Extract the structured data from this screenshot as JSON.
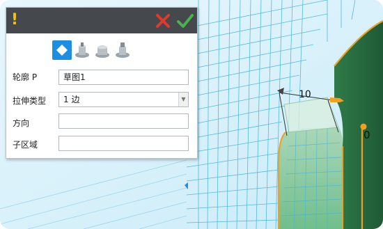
{
  "dialog": {
    "warn_glyph": "!",
    "cancel_icon": "close-x-icon",
    "ok_icon": "check-icon",
    "tools": [
      {
        "icon": "profile-diamond-icon",
        "active": true
      },
      {
        "icon": "extrude-solid-icon",
        "active": false
      },
      {
        "icon": "extrude-shell-icon",
        "active": false
      },
      {
        "icon": "extrude-cut-icon",
        "active": false
      }
    ],
    "fields": {
      "profile": {
        "label": "轮廓 P",
        "value": "草图1"
      },
      "extrude_type": {
        "label": "拉伸类型",
        "value": "1 边"
      },
      "direction": {
        "label": "方向",
        "value": ""
      },
      "subregion": {
        "label": "子区域",
        "value": ""
      }
    }
  },
  "viewport": {
    "dimension_value": "10",
    "end_marker": "0"
  },
  "colors": {
    "titlebar": "#45494e",
    "accent_blue": "#1d8fe3",
    "cancel_red": "#e03a2d",
    "ok_green": "#49b24a",
    "grid_blue": "#3ab0e0",
    "surface_green": "#3f9e5f",
    "edge_orange": "#f0a020"
  }
}
